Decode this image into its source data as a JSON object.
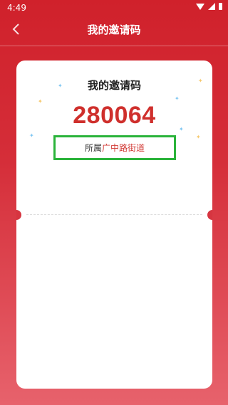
{
  "status_bar": {
    "time": "4:49"
  },
  "nav": {
    "title": "我的邀请码"
  },
  "card": {
    "title": "我的邀请码",
    "invite_code": "280064",
    "affiliation_prefix": "所属",
    "affiliation_value": "广中路街道"
  },
  "colors": {
    "primary_red": "#d32a34",
    "code_red": "#cf2f2c",
    "highlight_green": "#2ab33a",
    "card_bg": "#ffffff"
  }
}
